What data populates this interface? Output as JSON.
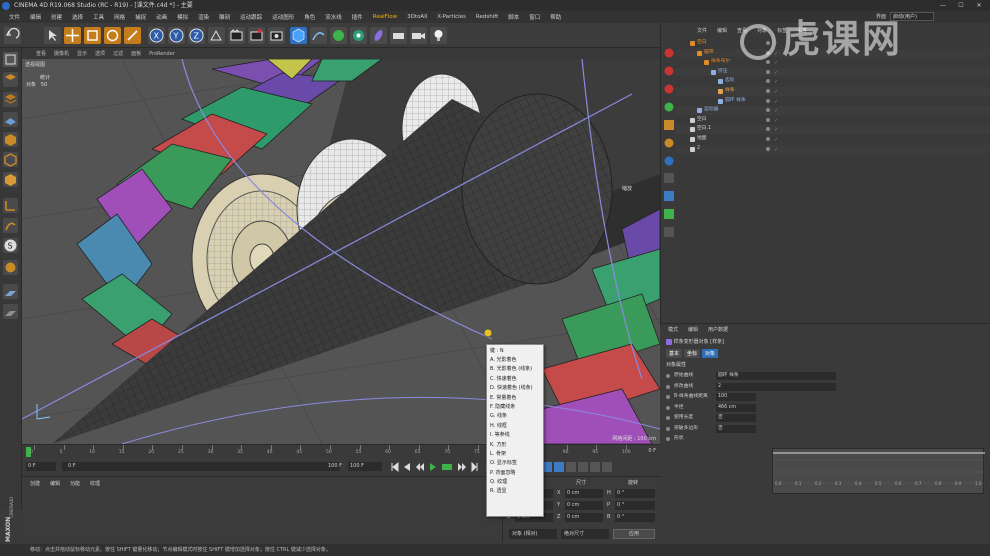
{
  "window": {
    "title": "CINEMA 4D R19.068 Studio (RC - R19) - [课文件.c4d *] - 主要",
    "controls": [
      "—",
      "☐",
      "✕"
    ],
    "layout_label": "界面",
    "layout_value": "启动(用户)"
  },
  "menubar": [
    "文件",
    "编辑",
    "创建",
    "选择",
    "工具",
    "网格",
    "捕捉",
    "动画",
    "模拟",
    "渲染",
    "雕刻",
    "运动跟踪",
    "运动图形",
    "角色",
    "流水线",
    "插件",
    "RealFlow",
    "3DtoAll",
    "X-Particles",
    "Redshift",
    "脚本",
    "窗口",
    "帮助"
  ],
  "menubar_highlight": "RealFlow",
  "viewport": {
    "menu": [
      "查看",
      "摄像机",
      "显示",
      "选项",
      "过滤",
      "面板",
      "ProRender"
    ],
    "label": "透视视图",
    "stats_header": "统计",
    "stats_label": "对象",
    "stats_value": "50",
    "zoom_label": "缩放",
    "grid_label": "网格间距 : 100 cm"
  },
  "context_menu": {
    "header": "键 : N",
    "items": [
      "A. 光影着色",
      "B. 光影着色 (线条)",
      "C. 快速着色",
      "D. 快速着色 (线条)",
      "E. 常量着色",
      "F. 隐藏线条",
      "G. 线条",
      "H. 线框",
      "I. 等参线",
      "K. 方形",
      "L. 骨架",
      "O. 显示标签",
      "P. 背面忽略",
      "Q. 纹理",
      "R. 透显"
    ]
  },
  "timeline": {
    "ticks": [
      "0",
      "5",
      "10",
      "15",
      "20",
      "25",
      "30",
      "35",
      "40",
      "45",
      "50",
      "55",
      "60",
      "65",
      "70",
      "75",
      "80",
      "85",
      "90",
      "95",
      "100"
    ],
    "end_label": "0 F",
    "frame_start": "0 F",
    "frame_current": "0 F",
    "frame_end": "100 F",
    "frame_max": "100 F"
  },
  "material_panel": {
    "menu": [
      "创建",
      "编辑",
      "功能",
      "纹理"
    ]
  },
  "coord_panel": {
    "headers": [
      "位置",
      "尺寸",
      "旋转"
    ],
    "rows": [
      {
        "axis": "X",
        "pos": "0 cm",
        "size": "0 cm",
        "rot_axis": "H",
        "rot": "0 °"
      },
      {
        "axis": "Y",
        "pos": "0 cm",
        "size": "0 cm",
        "rot_axis": "P",
        "rot": "0 °"
      },
      {
        "axis": "Z",
        "pos": "0 cm",
        "size": "0 cm",
        "rot_axis": "B",
        "rot": "0 °"
      }
    ],
    "mode": "对象 (相对)",
    "size_mode": "绝对尺寸",
    "apply": "应用"
  },
  "object_manager": {
    "menu": [
      "文件",
      "编辑",
      "查看",
      "对象",
      "标签",
      "书签"
    ],
    "rows": [
      {
        "indent": 0,
        "name": "空白",
        "color": "#e08a2a"
      },
      {
        "indent": 1,
        "name": "履带",
        "color": "#e08a2a"
      },
      {
        "indent": 2,
        "name": "样条布尔",
        "color": "#e08a2a"
      },
      {
        "indent": 3,
        "name": "挤压",
        "color": "#8fb0e0"
      },
      {
        "indent": 4,
        "name": "齿轮",
        "color": "#8fb0e0"
      },
      {
        "indent": 4,
        "name": "样条",
        "color": "#e8a04a"
      },
      {
        "indent": 4,
        "name": "圆环 样条",
        "color": "#8fb0e0"
      },
      {
        "indent": 1,
        "name": "运动器",
        "color": "#8fb0e0"
      },
      {
        "indent": 0,
        "name": "空白",
        "color": "#cfcfcf"
      },
      {
        "indent": 0,
        "name": "空白.1",
        "color": "#cfcfcf"
      },
      {
        "indent": 0,
        "name": "地面",
        "color": "#cfcfcf"
      },
      {
        "indent": 0,
        "name": "2",
        "color": "#cfcfcf"
      }
    ]
  },
  "attribute_manager": {
    "menu": [
      "模式",
      "编辑",
      "用户数据"
    ],
    "title": "样条变形器对象 [样条]",
    "tabs": [
      "基本",
      "坐标",
      "对象"
    ],
    "active_tab": "对象",
    "section": "对象属性",
    "fields": [
      {
        "label": "原始曲线",
        "value": "圆环 样条"
      },
      {
        "label": "修改曲线",
        "value": "2"
      },
      {
        "label": "B-样条曲线距离",
        "value": "100"
      },
      {
        "label": "半径",
        "value": "466 cm"
      },
      {
        "label": "使用长度",
        "value": "否"
      },
      {
        "label": "突破多边形",
        "value": "否"
      },
      {
        "label": "形状",
        "value": ""
      }
    ],
    "graph_ticks": [
      "0.0",
      "0.1",
      "0.2",
      "0.3",
      "0.4",
      "0.5",
      "0.6",
      "0.7",
      "0.8",
      "0.9",
      "1.0"
    ]
  },
  "statusbar": "移动：点击并拖动鼠标移动元素。按住 SHIFT 键量化移动；节点编辑模式时按住 SHIFT 键增加选择对象；按住 CTRL 键减少选择对象。",
  "watermark": "虎课网",
  "brand": "MAXON CINEMA4D"
}
